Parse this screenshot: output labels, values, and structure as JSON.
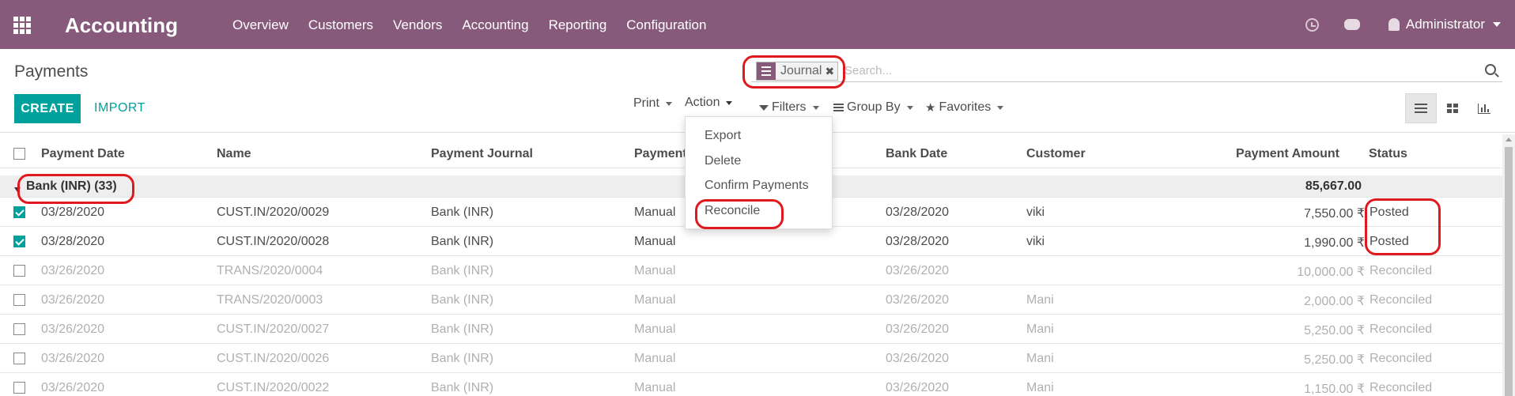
{
  "app": {
    "title": "Accounting",
    "menu": [
      "Overview",
      "Customers",
      "Vendors",
      "Accounting",
      "Reporting",
      "Configuration"
    ],
    "user": "Administrator"
  },
  "control_panel": {
    "breadcrumb": "Payments",
    "create_label": "CREATE",
    "import_label": "IMPORT",
    "print_label": "Print",
    "action_label": "Action",
    "filters_label": "Filters",
    "groupby_label": "Group By",
    "favorites_label": "Favorites",
    "facet_label": "Journal",
    "search_placeholder": "Search..."
  },
  "action_menu": [
    "Export",
    "Delete",
    "Confirm Payments",
    "Reconcile"
  ],
  "table": {
    "columns": [
      "Payment Date",
      "Name",
      "Payment Journal",
      "Payment",
      "Bank Date",
      "Customer",
      "Payment Amount",
      "Status"
    ],
    "group": {
      "label": "Bank (INR) (33)",
      "total": "85,667.00"
    },
    "rows": [
      {
        "date": "03/28/2020",
        "name": "CUST.IN/2020/0029",
        "journal": "Bank (INR)",
        "method": "Manual",
        "bank_date": "03/28/2020",
        "customer": "viki",
        "amount": "7,550.00 ₹",
        "status": "Posted",
        "checked": true
      },
      {
        "date": "03/28/2020",
        "name": "CUST.IN/2020/0028",
        "journal": "Bank (INR)",
        "method": "Manual",
        "bank_date": "03/28/2020",
        "customer": "viki",
        "amount": "1,990.00 ₹",
        "status": "Posted",
        "checked": true
      },
      {
        "date": "03/26/2020",
        "name": "TRANS/2020/0004",
        "journal": "Bank (INR)",
        "method": "Manual",
        "bank_date": "03/26/2020",
        "customer": "",
        "amount": "10,000.00 ₹",
        "status": "Reconciled",
        "checked": false
      },
      {
        "date": "03/26/2020",
        "name": "TRANS/2020/0003",
        "journal": "Bank (INR)",
        "method": "Manual",
        "bank_date": "03/26/2020",
        "customer": "Mani",
        "amount": "2,000.00 ₹",
        "status": "Reconciled",
        "checked": false
      },
      {
        "date": "03/26/2020",
        "name": "CUST.IN/2020/0027",
        "journal": "Bank (INR)",
        "method": "Manual",
        "bank_date": "03/26/2020",
        "customer": "Mani",
        "amount": "5,250.00 ₹",
        "status": "Reconciled",
        "checked": false
      },
      {
        "date": "03/26/2020",
        "name": "CUST.IN/2020/0026",
        "journal": "Bank (INR)",
        "method": "Manual",
        "bank_date": "03/26/2020",
        "customer": "Mani",
        "amount": "5,250.00 ₹",
        "status": "Reconciled",
        "checked": false
      },
      {
        "date": "03/26/2020",
        "name": "CUST.IN/2020/0022",
        "journal": "Bank (INR)",
        "method": "Manual",
        "bank_date": "03/26/2020",
        "customer": "Mani",
        "amount": "1,150.00 ₹",
        "status": "Reconciled",
        "checked": false
      }
    ]
  },
  "colors": {
    "brand": "#875a7b",
    "primary": "#00a09d",
    "annotation": "#e0191e"
  }
}
